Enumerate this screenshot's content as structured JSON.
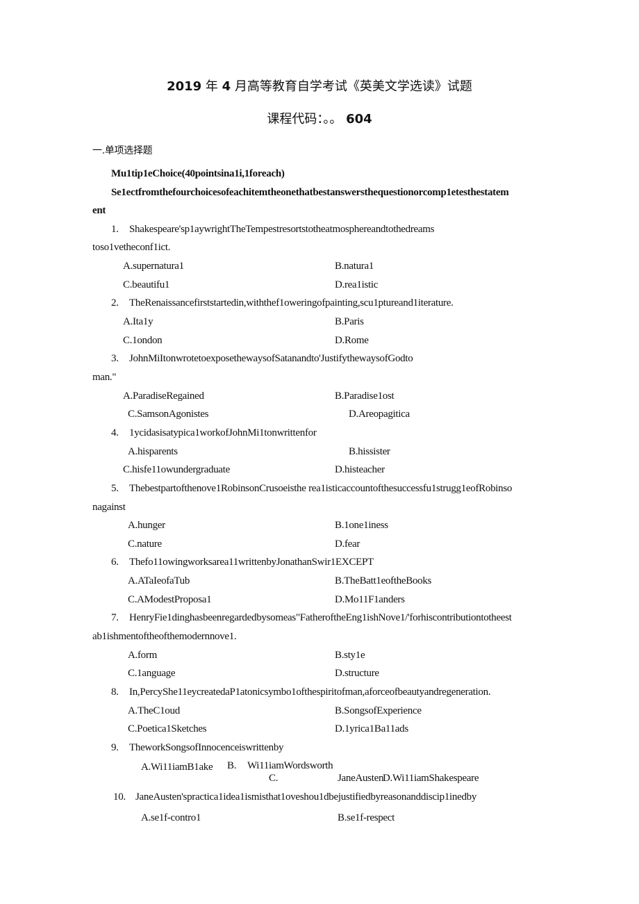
{
  "document": {
    "title_year": "2019",
    "title_mid1": "年",
    "title_month": "4",
    "title_rest": "月高等教育自学考试《英美文学选读》试题",
    "course_code_label": "课程代码：。。",
    "course_code_value": "604",
    "section_heading": "一.单项选择题",
    "instruction_1": "Mu1tip1eChoice(40pointsina1i,1foreach)",
    "instruction_2a": "Se1ectfromthefourchoicesofeachitemtheonethatbestanswersthequestionorcomp1etesthestatem",
    "instruction_2b": "ent",
    "questions": [
      {
        "number": "1.",
        "text": "Shakespeare'sp1aywrightTheTempestresortstotheatmosphereandtothedreams",
        "text_cont": "toso1vetheconf1ict.",
        "options": [
          "A.supernatura1",
          "B.natura1",
          "C.beautifu1",
          "D.rea1istic"
        ]
      },
      {
        "number": "2.",
        "text": "TheRenaissancefirststartedin,withthef1oweringofpainting,scu1ptureand1iterature.",
        "options": [
          "A.Ita1y",
          "B.Paris",
          "C.1ondon",
          "D.Rome"
        ]
      },
      {
        "number": "3.",
        "text": "JohnMiItonwrotetoexposethewaysofSatanandto'JustifythewaysofGodto",
        "text_cont": "man.\"",
        "options": [
          "A.ParadiseRegained",
          "B.Paradise1ost",
          "C.SamsonAgonistes",
          "D.Areopagitica"
        ]
      },
      {
        "number": "4.",
        "text": "1ycidasisatypica1workofJohnMi1tonwrittenfor",
        "options": [
          "A.hisparents",
          "B.hissister",
          "C.hisfe11owundergraduate",
          "D.histeacher"
        ]
      },
      {
        "number": "5.",
        "text": "Thebestpartofthenove1RobinsonCrusoeisthe rea1isticaccountofthesuccessfu1strugg1eofRobinso",
        "text_cont": "nagainst",
        "options": [
          "A.hunger",
          "B.1one1iness",
          "C.nature",
          "D.fear"
        ]
      },
      {
        "number": "6.",
        "text": "Thefo11owingworksarea11writtenbyJonathanSwir1EXCEPT",
        "options": [
          "A.ATaIeofaTub",
          "B.TheBatt1eoftheBooks",
          "C.AModestProposa1",
          "D.Mo11F1anders"
        ]
      },
      {
        "number": "7.",
        "text": "HenryFie1dinghasbeenregardedbysomeas\"FatheroftheEng1ishNove1/'forhiscontributiontotheest",
        "text_cont": "ab1ishmentoftheofthemodernnove1.",
        "options": [
          "A.form",
          "B.sty1e",
          "C.1anguage",
          "D.structure"
        ]
      },
      {
        "number": "8.",
        "text": "In,PercyShe11eycreatedaP1atonicsymbo1ofthespiritofman,aforceofbeautyandregeneration.",
        "options": [
          "A.TheC1oud",
          "B.SongsofExperience",
          "C.Poetica1Sketches",
          "D.1yrica1Ba11ads"
        ]
      },
      {
        "number": "9.",
        "text": "TheworkSongsofInnocenceiswrittenby",
        "options": [
          "A.Wi11iamB1ake",
          "B.",
          "Wi11iamWordsworth",
          "C.",
          "JaneAusten",
          "D.Wi11iamShakespeare"
        ]
      },
      {
        "number": "10.",
        "text": "JaneAusten'spractica1idea1ismisthat1oveshou1dbejustifiedbyreasonanddiscip1inedby",
        "options": [
          "A.se1f-contro1",
          "B.se1f-respect"
        ]
      }
    ]
  }
}
